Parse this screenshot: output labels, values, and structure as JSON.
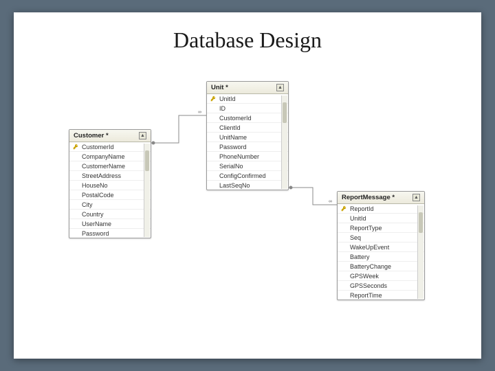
{
  "title": "Database Design",
  "entities": {
    "customer": {
      "name": "Customer *",
      "fields": [
        {
          "name": "CustomerId",
          "pk": true
        },
        {
          "name": "CompanyName",
          "pk": false
        },
        {
          "name": "CustomerName",
          "pk": false
        },
        {
          "name": "StreetAddress",
          "pk": false
        },
        {
          "name": "HouseNo",
          "pk": false
        },
        {
          "name": "PostalCode",
          "pk": false
        },
        {
          "name": "City",
          "pk": false
        },
        {
          "name": "Country",
          "pk": false
        },
        {
          "name": "UserName",
          "pk": false
        },
        {
          "name": "Password",
          "pk": false
        }
      ]
    },
    "unit": {
      "name": "Unit *",
      "fields": [
        {
          "name": "UnitId",
          "pk": true
        },
        {
          "name": "ID",
          "pk": false
        },
        {
          "name": "CustomerId",
          "pk": false
        },
        {
          "name": "ClientId",
          "pk": false
        },
        {
          "name": "UnitName",
          "pk": false
        },
        {
          "name": "Password",
          "pk": false
        },
        {
          "name": "PhoneNumber",
          "pk": false
        },
        {
          "name": "SerialNo",
          "pk": false
        },
        {
          "name": "ConfigConfirmed",
          "pk": false
        },
        {
          "name": "LastSeqNo",
          "pk": false
        }
      ]
    },
    "report": {
      "name": "ReportMessage *",
      "fields": [
        {
          "name": "ReportId",
          "pk": true
        },
        {
          "name": "UnitId",
          "pk": false
        },
        {
          "name": "ReportType",
          "pk": false
        },
        {
          "name": "Seq",
          "pk": false
        },
        {
          "name": "WakeUpEvent",
          "pk": false
        },
        {
          "name": "Battery",
          "pk": false
        },
        {
          "name": "BatteryChange",
          "pk": false
        },
        {
          "name": "GPSWeek",
          "pk": false
        },
        {
          "name": "GPSSeconds",
          "pk": false
        },
        {
          "name": "ReportTime",
          "pk": false
        }
      ]
    }
  },
  "relationships": [
    {
      "from": "customer",
      "to": "unit",
      "cardinality": "1-to-many"
    },
    {
      "from": "unit",
      "to": "report",
      "cardinality": "1-to-many"
    }
  ],
  "icons": {
    "collapse": "▲",
    "expand": "▼"
  }
}
